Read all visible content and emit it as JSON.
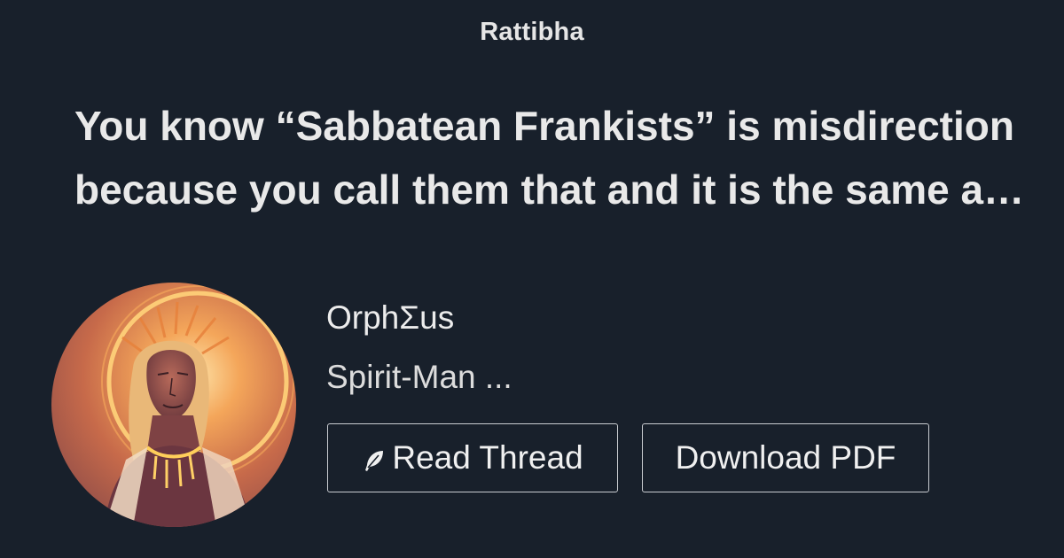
{
  "site": {
    "name": "Rattibha"
  },
  "thread": {
    "title": "You know “Sabbatean Frankists” is misdirection because you call them that and it is the same as calling them the elite"
  },
  "author": {
    "name": "OrphΣus",
    "bio": "Spirit-Man ...",
    "avatar_icon": "haloed-figure-avatar"
  },
  "actions": {
    "read_thread_label": "Read Thread",
    "read_thread_icon": "feather-icon",
    "download_pdf_label": "Download PDF"
  },
  "colors": {
    "background": "#18202b",
    "text": "#e8e8e8",
    "button_border": "#c9ccd1",
    "avatar_glow": "#f2a04a"
  }
}
